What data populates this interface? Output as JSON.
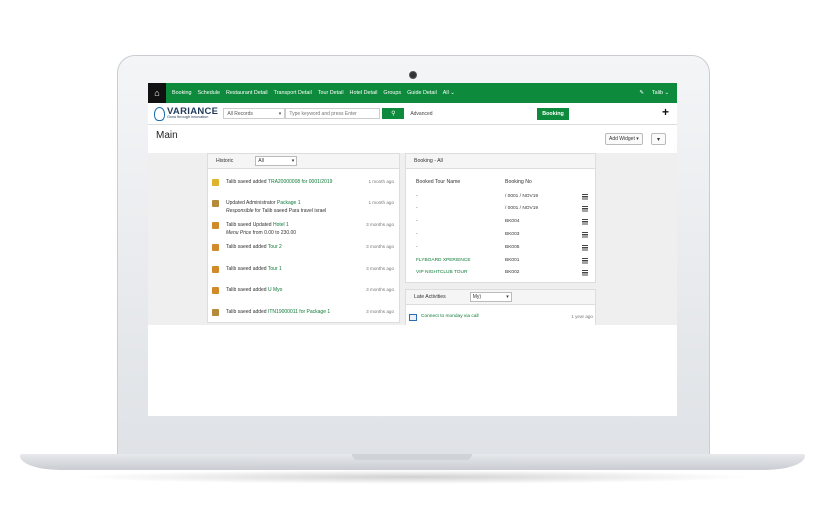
{
  "nav": {
    "home_icon": "home-icon",
    "items": [
      "Booking",
      "Schedule",
      "Restaurant Detail",
      "Transport Detail",
      "Tour Detail",
      "Hotel Detail",
      "Groups",
      "Guide Detail",
      "All"
    ],
    "user": "Talib"
  },
  "logo": {
    "name": "VARIANCE",
    "tagline": "Grow through innovation"
  },
  "search": {
    "record_type": "All Records",
    "placeholder": "Type keyword and press Enter",
    "advanced": "Advanced"
  },
  "toolbar": {
    "booking_label": "Booking",
    "plus_label": "+"
  },
  "page": {
    "title": "Main",
    "add_widget": "Add Widget",
    "add_widget_caret": "▾",
    "more_caret": "▾"
  },
  "historic": {
    "title": "Historic",
    "filter": "All",
    "rows": [
      {
        "icon_color": "#e0b32c",
        "user": "Talib saeed",
        "verb": "added",
        "link": "TRA20000008 for 0001/2019",
        "time": "1 month ago"
      },
      {
        "icon_color": "#b58a3a",
        "line1_pre": "Updated",
        "line1_bold": "Administrator",
        "line1_link": "Package 1",
        "line2_italic": "Responsible",
        "line2_mid": "for",
        "line2_a": "Talib saeed",
        "line2_b": "Para",
        "line2_c": "travel israel",
        "time": "1 month ago"
      },
      {
        "icon_color": "#d08a2a",
        "user": "Talib saeed",
        "verb": "Updated",
        "link": "Hotel 1",
        "line2_italic": "Menu Price",
        "line2_mid": "from",
        "line2_a": "0.00",
        "line2_b": "to",
        "line2_c": "230.00",
        "time": "3 months ago"
      },
      {
        "icon_color": "#d08a2a",
        "user": "Talib saeed",
        "verb": "added",
        "link": "Tour 2",
        "time": "3 months ago"
      },
      {
        "icon_color": "#d08a2a",
        "user": "Talib saeed",
        "verb": "added",
        "link": "Tour 1",
        "time": "3 months ago"
      },
      {
        "icon_color": "#d08a2a",
        "user": "Talib saeed",
        "verb": "added",
        "link": "U Myo",
        "time": "3 months ago"
      },
      {
        "icon_color": "#b58a3a",
        "user": "Talib saeed",
        "verb": "added",
        "link": "ITN19000011 for Package 1",
        "time": "3 months ago"
      }
    ]
  },
  "booking": {
    "title": "Booking - All",
    "columns": [
      "Booked Tour Name",
      "Booking No"
    ],
    "rows": [
      {
        "name": "-",
        "no": "/ 0001 / NOV19"
      },
      {
        "name": "-",
        "no": "/ 0001 / NOV19"
      },
      {
        "name": "-",
        "no": "BK004"
      },
      {
        "name": "-",
        "no": "BK003"
      },
      {
        "name": "-",
        "no": "BK005"
      },
      {
        "name": "FLYBOARD XPERIENCE",
        "no": "BK001"
      },
      {
        "name": "VIP NIGHTCLUB TOUR",
        "no": "BK002"
      }
    ]
  },
  "late": {
    "title": "Late Activities",
    "filter": "My)",
    "rows": [
      {
        "text": "Connect to monday via call",
        "time": "1 year ago"
      }
    ]
  },
  "colors": {
    "brand_green": "#0d8a3b",
    "link_green": "#0d7a37"
  }
}
